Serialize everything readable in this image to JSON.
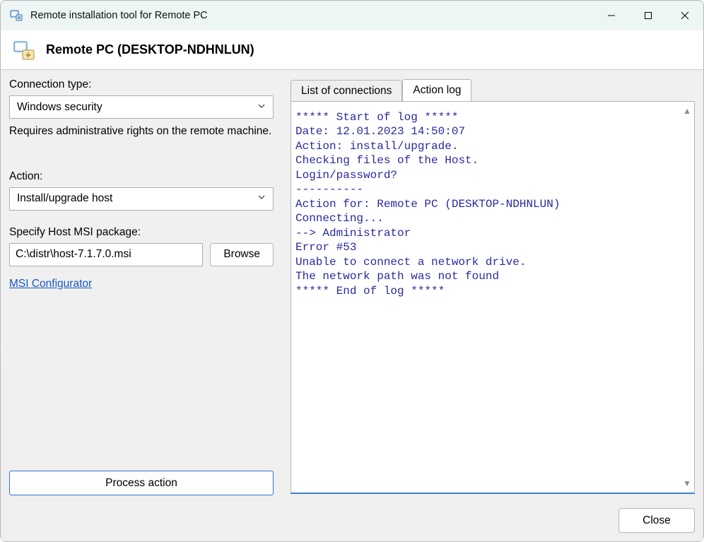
{
  "window": {
    "title": "Remote installation tool for Remote PC"
  },
  "header": {
    "heading": "Remote PC (DESKTOP-NDHNLUN)"
  },
  "left": {
    "conn_label": "Connection type:",
    "conn_value": "Windows security",
    "conn_note": "Requires administrative rights on the remote machine.",
    "action_label": "Action:",
    "action_value": "Install/upgrade host",
    "msi_label": "Specify Host MSI package:",
    "msi_path": "C:\\distr\\host-7.1.7.0.msi",
    "browse": "Browse",
    "msi_link": "MSI Configurator",
    "process": "Process action"
  },
  "tabs": {
    "list": "List of connections",
    "log": "Action log"
  },
  "log_text": "***** Start of log *****\nDate: 12.01.2023 14:50:07\nAction: install/upgrade.\nChecking files of the Host.\nLogin/password?\n----------\nAction for: Remote PC (DESKTOP-NDHNLUN)\nConnecting...\n--> Administrator\nError #53\nUnable to connect a network drive.\nThe network path was not found\n***** End of log *****",
  "footer": {
    "close": "Close"
  }
}
